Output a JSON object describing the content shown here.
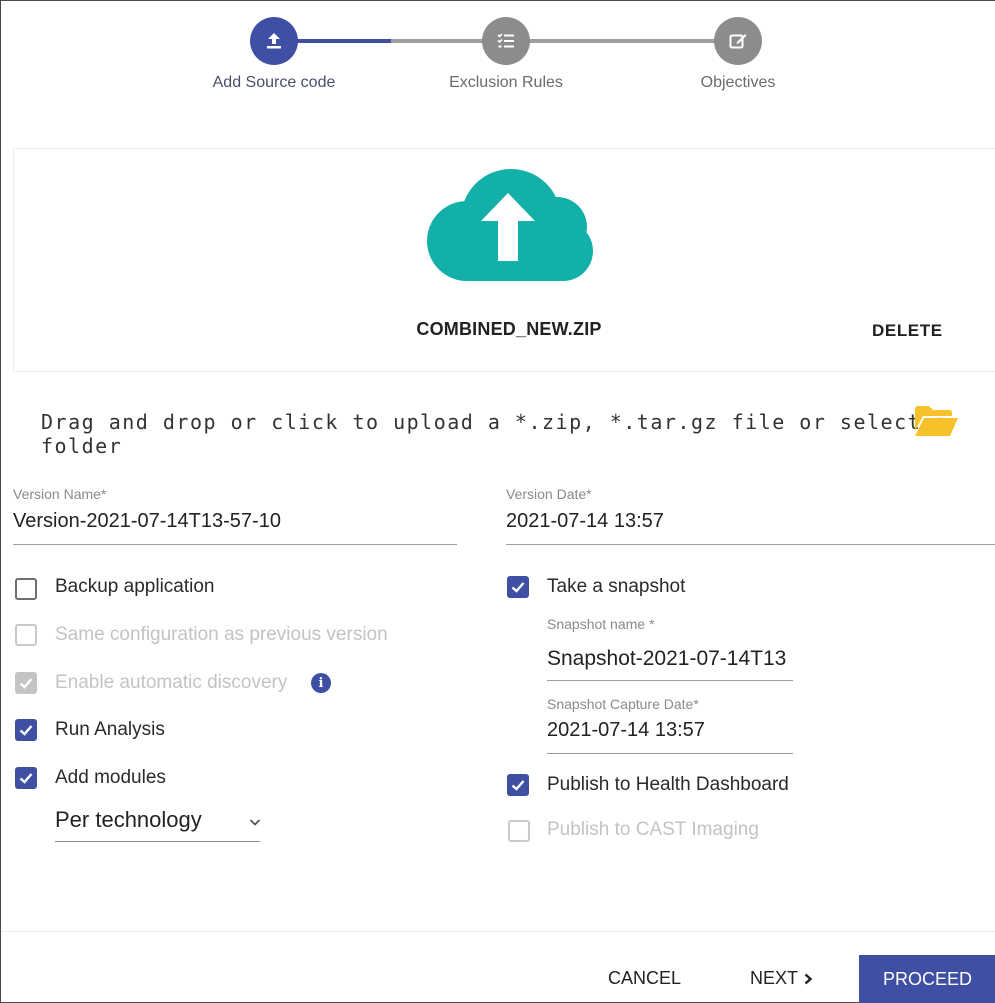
{
  "stepper": {
    "steps": [
      {
        "label": "Add Source code",
        "icon": "upload-icon",
        "state": "active"
      },
      {
        "label": "Exclusion Rules",
        "icon": "checklist-icon",
        "state": "inactive"
      },
      {
        "label": "Objectives",
        "icon": "edit-icon",
        "state": "inactive"
      }
    ]
  },
  "upload": {
    "icon": "cloud-upload-icon",
    "file_name": "COMBINED_NEW.ZIP",
    "delete_label": "DELETE",
    "drop_text": "Drag and drop or click to upload a *.zip, *.tar.gz file or select a folder",
    "folder_icon": "folder-open-icon"
  },
  "version_name": {
    "label": "Version Name*",
    "value": "Version-2021-07-14T13-57-10"
  },
  "version_date": {
    "label": "Version Date*",
    "value": "2021-07-14 13:57"
  },
  "left_options": [
    {
      "label": "Backup application",
      "checked": false,
      "disabled": false
    },
    {
      "label": "Same configuration as previous version",
      "checked": false,
      "disabled": true
    },
    {
      "label": "Enable automatic discovery",
      "checked": true,
      "disabled": true
    },
    {
      "label": "Run Analysis",
      "checked": true,
      "disabled": false
    },
    {
      "label": "Add modules",
      "checked": true,
      "disabled": false
    }
  ],
  "modules_select": {
    "value": "Per technology"
  },
  "snapshot": {
    "take_label": "Take a snapshot",
    "take_checked": true,
    "name_label": "Snapshot name *",
    "name_value": "Snapshot-2021-07-14T13",
    "date_label": "Snapshot Capture Date*",
    "date_value": "2021-07-14 13:57",
    "publish_health_label": "Publish to Health Dashboard",
    "publish_health_checked": true,
    "publish_imaging_label": "Publish to CAST Imaging",
    "publish_imaging_checked": false
  },
  "footer": {
    "cancel_label": "CANCEL",
    "next_label": "NEXT",
    "proceed_label": "PROCEED"
  },
  "colors": {
    "primary": "#3f4fa3",
    "cloud": "#12b0a8",
    "folder": "#f6c12a",
    "inactive_step": "#8c8c8c"
  }
}
